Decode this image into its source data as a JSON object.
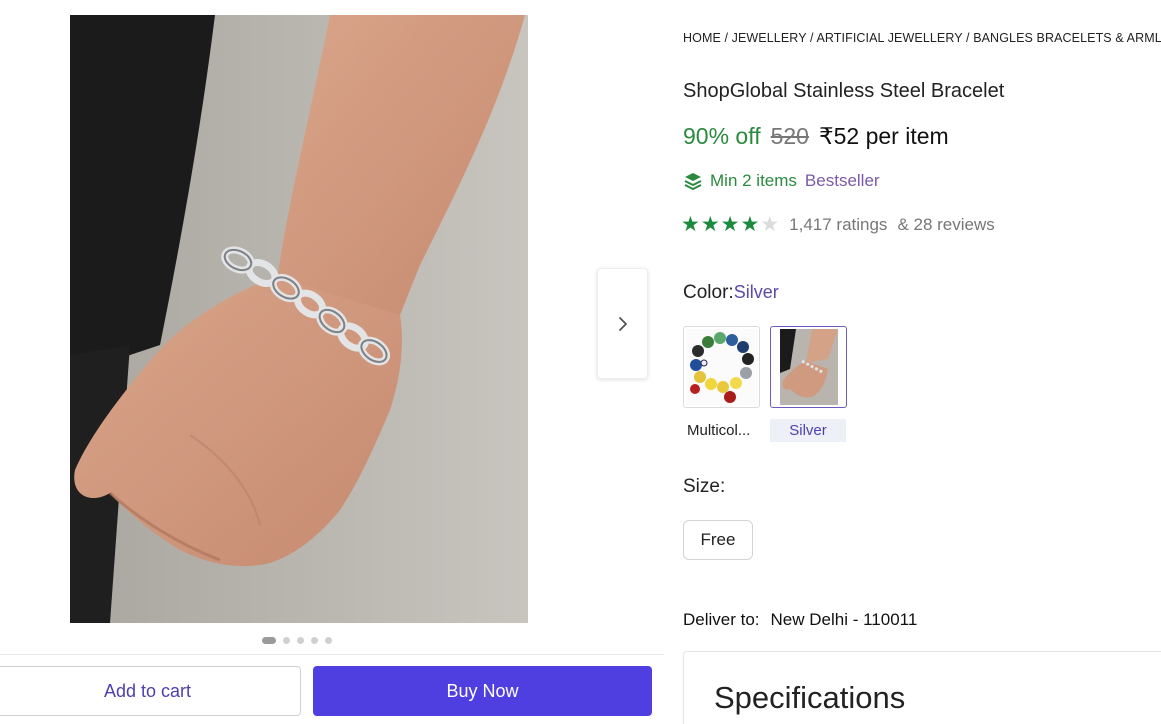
{
  "gallery": {
    "image_alt": "Man's wrist wearing a silver stainless steel chain bracelet",
    "dots_count": 5,
    "active_dot": 1,
    "next_icon": "chevron-right-icon"
  },
  "actions": {
    "add_to_cart_label": "Add to cart",
    "buy_now_label": "Buy Now"
  },
  "breadcrumb": [
    "HOME",
    "JEWELLERY",
    "ARTIFICIAL JEWELLERY",
    "BANGLES BRACELETS & ARMLETS"
  ],
  "product": {
    "title": "ShopGlobal Stainless Steel Bracelet",
    "discount": "90% off",
    "mrp": "520",
    "price": "₹52 per item",
    "min_items": "Min 2 items",
    "min_items_icon": "layers-icon",
    "bestseller": "Bestseller",
    "rating_stars": 4,
    "rating_max": 5,
    "ratings_text": "1,417 ratings",
    "reviews_text": "& 28 reviews"
  },
  "color": {
    "label": "Color:",
    "selected": "Silver",
    "options": [
      {
        "label": "Multicol...",
        "selected": false
      },
      {
        "label": "Silver",
        "selected": true
      }
    ]
  },
  "size": {
    "label": "Size:",
    "options": [
      "Free"
    ]
  },
  "delivery": {
    "label": "Deliver to:",
    "location": "New Delhi - 110011"
  },
  "specifications": {
    "title": "Specifications"
  },
  "colors": {
    "accent": "#4f3ee0",
    "discount_green": "#2b8a3e",
    "star_green": "#1c8a3c",
    "bestseller_purple": "#7a5aa8"
  }
}
